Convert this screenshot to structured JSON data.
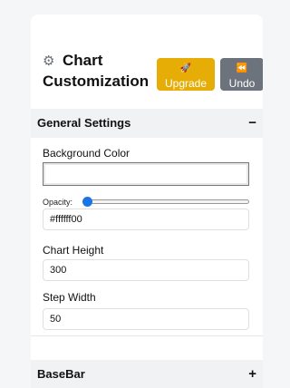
{
  "header": {
    "title_line1": "Chart",
    "title_line2": "Customization",
    "icon": "gear-icon",
    "upgrade_button": {
      "icon": "rocket-icon",
      "label": "Upgrade",
      "color": "#e5ad06"
    },
    "undo_button": {
      "icon": "rewind-icon",
      "label": "Undo",
      "color": "#6c737d"
    }
  },
  "general_settings": {
    "title": "General Settings",
    "toggle": "−",
    "background_color_label": "Background Color",
    "opacity_label": "Opacity:",
    "opacity_value": 0,
    "color_value": "#ffffff00",
    "chart_height_label": "Chart Height",
    "chart_height_value": "300",
    "step_width_label": "Step Width",
    "step_width_value": "50"
  },
  "basebar": {
    "title": "BaseBar",
    "toggle": "+"
  },
  "colors": {
    "slider_thumb": "#1a73e8",
    "section_header_bg": "#f1f2f4"
  }
}
